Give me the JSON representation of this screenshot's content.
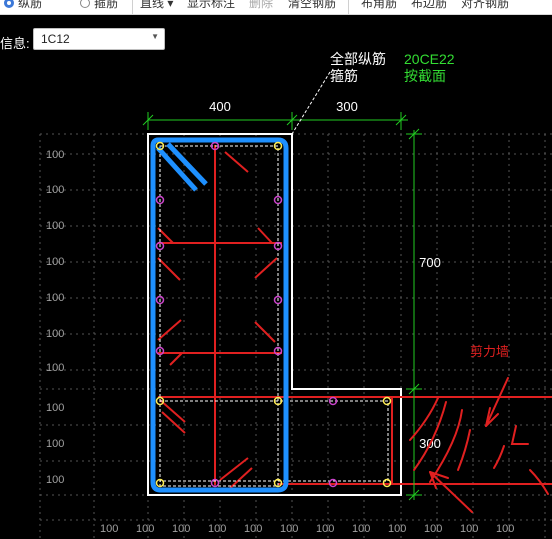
{
  "toolbar": {
    "radio_longitudinal": "纵筋",
    "radio_stirrup": "箍筋",
    "line_dropdown": "直线",
    "show_annotation": "显示标注",
    "delete": "删除",
    "clear_rebar": "清空钢筋",
    "arrange_rebar": "布角筋",
    "edge_rebar": "布边筋",
    "align_rebar": "对齐钢筋"
  },
  "info": {
    "label": "信息:",
    "value": "1C12"
  },
  "canvas": {
    "legend_all_long": "全部纵筋",
    "legend_stirrup": "箍筋",
    "legend_code": "20CE22",
    "legend_section": "按截面",
    "dim_top_left": "400",
    "dim_top_right": "300",
    "dim_right_top": "700",
    "dim_right_bottom": "300",
    "shear_wall_label": "剪力墙",
    "grid_label": "100",
    "colors": {
      "outline": "#ffffff",
      "stirrup_blue": "#1e90ff",
      "rebar_red": "#e02020",
      "dimension_green": "#22cc22",
      "legend_green": "#33dd33",
      "node_magenta": "#cc44cc",
      "node_yellow": "#ffee55"
    }
  }
}
